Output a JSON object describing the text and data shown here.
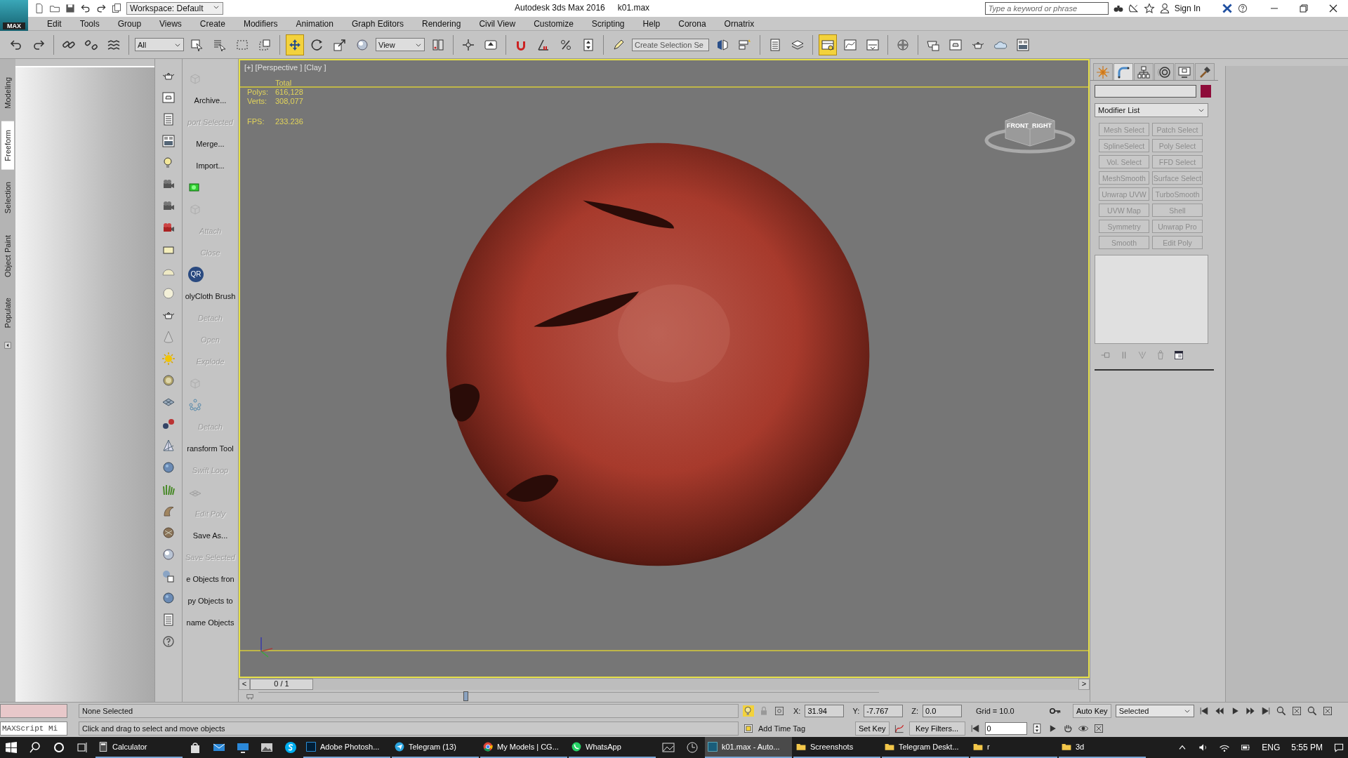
{
  "app_logo": "MAX",
  "title_bar": {
    "workspace": "Workspace: Default",
    "title": "Autodesk 3ds Max 2016",
    "file": "k01.max",
    "search": {
      "placeholder": "Type a keyword or phrase"
    },
    "sign_in": "Sign In"
  },
  "menu": [
    "Edit",
    "Tools",
    "Group",
    "Views",
    "Create",
    "Modifiers",
    "Animation",
    "Graph Editors",
    "Rendering",
    "Civil View",
    "Customize",
    "Scripting",
    "Help",
    "Corona",
    "Ornatrix"
  ],
  "toolbar": [
    [
      {
        "kind": "tool",
        "selected": false
      },
      {
        "kind": "tool",
        "selected": false
      }
    ],
    [
      {
        "kind": "tool",
        "selected": false
      },
      {
        "kind": "tool",
        "selected": false
      },
      {
        "kind": "tool",
        "selected": false
      }
    ],
    [
      {
        "kind": "dropdown",
        "value": "All"
      },
      {
        "kind": "tool",
        "selected": false
      },
      {
        "kind": "tool",
        "selected": false
      },
      {
        "kind": "tool",
        "selected": false
      },
      {
        "kind": "tool",
        "selected": false
      }
    ],
    [
      {
        "kind": "tool",
        "selected": true
      },
      {
        "kind": "tool",
        "selected": false
      },
      {
        "kind": "tool",
        "selected": false
      },
      {
        "kind": "tool",
        "selected": false
      },
      {
        "kind": "dropdown",
        "value": "View"
      },
      {
        "kind": "tool",
        "selected": false
      }
    ],
    [
      {
        "kind": "tool",
        "selected": false
      },
      {
        "kind": "tool",
        "selected": false
      }
    ],
    [
      {
        "kind": "tool",
        "selected": false
      },
      {
        "kind": "tool",
        "selected": false
      },
      {
        "kind": "tool",
        "selected": false
      },
      {
        "kind": "tool",
        "selected": false
      }
    ],
    [
      {
        "kind": "tool",
        "selected": false
      },
      {
        "kind": "field",
        "placeholder": "Create Selection Se"
      },
      {
        "kind": "tool",
        "selected": false
      },
      {
        "kind": "tool",
        "selected": false
      }
    ],
    [
      {
        "kind": "tool",
        "selected": false
      },
      {
        "kind": "tool",
        "selected": false
      }
    ],
    [
      {
        "kind": "tool",
        "selected": true
      },
      {
        "kind": "tool",
        "selected": false
      },
      {
        "kind": "tool",
        "selected": false
      }
    ],
    [
      {
        "kind": "tool",
        "selected": false
      }
    ],
    [
      {
        "kind": "tool",
        "selected": false
      },
      {
        "kind": "tool",
        "selected": false
      },
      {
        "kind": "tool",
        "selected": false
      },
      {
        "kind": "tool",
        "selected": false
      },
      {
        "kind": "tool",
        "selected": false
      }
    ]
  ],
  "ribbon_tabs": [
    {
      "label": "Modeling",
      "selected": false
    },
    {
      "label": "Freeform",
      "selected": true
    },
    {
      "label": "Selection",
      "selected": false
    },
    {
      "label": "Object Paint",
      "selected": false
    },
    {
      "label": "Populate",
      "selected": false
    }
  ],
  "scene_tools": [
    {
      "kind": "icon",
      "disabled": true
    },
    {
      "kind": "button",
      "label": "Archive...",
      "disabled": false
    },
    {
      "kind": "button",
      "label": "port Selected",
      "disabled": true
    },
    {
      "kind": "button",
      "label": "Merge...",
      "disabled": false
    },
    {
      "kind": "button",
      "label": "Import...",
      "disabled": false
    },
    {
      "kind": "icon",
      "disabled": false
    },
    {
      "kind": "icon",
      "disabled": true
    },
    {
      "kind": "button",
      "label": "Attach",
      "disabled": true
    },
    {
      "kind": "button",
      "label": "Close",
      "disabled": true
    },
    {
      "kind": "badge",
      "label": "QR"
    },
    {
      "kind": "button",
      "label": "olyCloth Brush",
      "disabled": false
    },
    {
      "kind": "button",
      "label": "Detach",
      "disabled": true
    },
    {
      "kind": "button",
      "label": "Open",
      "disabled": true
    },
    {
      "kind": "button",
      "label": "Explode",
      "disabled": true
    },
    {
      "kind": "icon",
      "disabled": true
    },
    {
      "kind": "icon",
      "disabled": false
    },
    {
      "kind": "button",
      "label": "Detach",
      "disabled": true
    },
    {
      "kind": "button",
      "label": "ransform Tool",
      "disabled": false
    },
    {
      "kind": "button",
      "label": "Swift Loop",
      "disabled": true
    },
    {
      "kind": "icon",
      "disabled": true
    },
    {
      "kind": "button",
      "label": "Edit Poly",
      "disabled": true
    },
    {
      "kind": "button",
      "label": "Save As...",
      "disabled": false
    },
    {
      "kind": "button",
      "label": "Save Selected",
      "disabled": true
    },
    {
      "kind": "button",
      "label": "e Objects fron",
      "disabled": false
    },
    {
      "kind": "button",
      "label": "py Objects to",
      "disabled": false
    },
    {
      "kind": "button",
      "label": "name Objects",
      "disabled": false
    }
  ],
  "viewport": {
    "label": "[+] [Perspective ] [Clay ]",
    "stats_heading": "Total",
    "stats": [
      {
        "name": "Polys:",
        "value": "616,128"
      },
      {
        "name": "Verts:",
        "value": "308,077"
      },
      {
        "name": "FPS:",
        "value": "233.236"
      }
    ],
    "viewcube": [
      "FRONT",
      "RIGHT"
    ]
  },
  "time_slider": {
    "prev": "<",
    "next": ">",
    "frame": "0 / 1",
    "level": 0
  },
  "track_bar": {
    "level": 0.33
  },
  "command_panel": {
    "tabs": [
      {
        "selected": false
      },
      {
        "selected": true
      },
      {
        "selected": false
      },
      {
        "selected": false
      },
      {
        "selected": false
      },
      {
        "selected": false
      }
    ],
    "color": "#8e0c3a",
    "modifier_list": "Modifier List",
    "modifiers": [
      {
        "label": "Mesh Select",
        "disabled": true
      },
      {
        "label": "Patch Select",
        "disabled": true
      },
      {
        "label": "SplineSelect",
        "disabled": true
      },
      {
        "label": "Poly Select",
        "disabled": true
      },
      {
        "label": "Vol. Select",
        "disabled": true
      },
      {
        "label": "FFD Select",
        "disabled": true
      },
      {
        "label": "MeshSmooth",
        "disabled": true
      },
      {
        "label": "Surface Select",
        "disabled": true
      },
      {
        "label": "Unwrap UVW",
        "disabled": true
      },
      {
        "label": "TurboSmooth",
        "disabled": true
      },
      {
        "label": "UVW Map",
        "disabled": true
      },
      {
        "label": "Shell",
        "disabled": true
      },
      {
        "label": "Symmetry",
        "disabled": true
      },
      {
        "label": "Unwrap Pro",
        "disabled": true
      },
      {
        "label": "Smooth",
        "disabled": true
      },
      {
        "label": "Edit Poly",
        "disabled": true
      }
    ]
  },
  "status_bar": {
    "maxscript": "MAXScript Mi",
    "selection": "None Selected",
    "prompt": "Click and drag to select and move objects",
    "coords": [
      {
        "axis": "X:",
        "value": "31.94"
      },
      {
        "axis": "Y:",
        "value": "-7.767"
      },
      {
        "axis": "Z:",
        "value": "0.0"
      }
    ],
    "grid": "Grid = 10.0",
    "add_time_tag": "Add Time Tag",
    "auto_key": "Auto Key",
    "set_key": "Set Key",
    "key_mode": "Selected",
    "key_filters": "Key Filters...",
    "frame": "0"
  },
  "taskbar": {
    "items": [
      {
        "kind": "app",
        "label": "Calculator",
        "selected": false
      },
      {
        "kind": "pinned"
      },
      {
        "kind": "pinned"
      },
      {
        "kind": "pinned"
      },
      {
        "kind": "pinned"
      },
      {
        "kind": "pinned"
      },
      {
        "kind": "app",
        "label": "Adobe Photosh...",
        "selected": false
      },
      {
        "kind": "app",
        "label": "Telegram (13)",
        "selected": false
      },
      {
        "kind": "app",
        "label": "My Models | CG...",
        "selected": false
      },
      {
        "kind": "app",
        "label": "WhatsApp",
        "selected": false
      },
      {
        "kind": "pinned"
      },
      {
        "kind": "pinned"
      },
      {
        "kind": "app",
        "label": "k01.max - Auto...",
        "selected": true
      },
      {
        "kind": "app",
        "label": "Screenshots",
        "selected": false
      },
      {
        "kind": "app",
        "label": "Telegram Deskt...",
        "selected": false
      },
      {
        "kind": "app",
        "label": "r",
        "selected": false
      },
      {
        "kind": "app",
        "label": "3d",
        "selected": false
      }
    ],
    "language": "ENG",
    "time": "5:55 PM"
  }
}
